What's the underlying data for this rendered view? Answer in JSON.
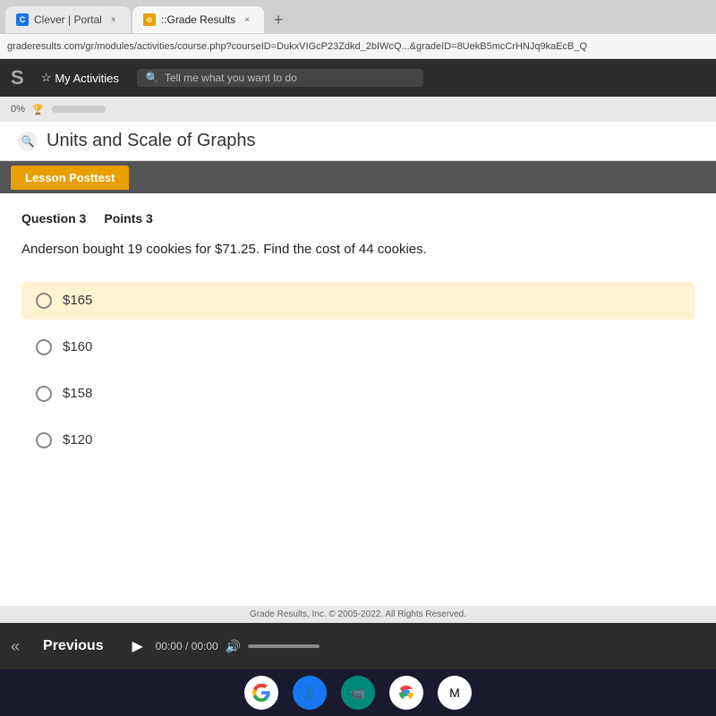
{
  "browser": {
    "tab1_label": "Clever | Portal",
    "tab2_label": "::Grade Results",
    "tab_close": "×",
    "tab_new": "+",
    "address_bar": "graderesults.com/gr/modules/activities/course.php?courseID=DukxVIGcP23Zdkd_2bIWcQ...&gradeID=8UekB5mcCrHNJq9kaEcB_Q"
  },
  "header": {
    "logo": "S",
    "nav_activities": "My Activities",
    "search_placeholder": "Tell me what you want to do",
    "progress_label": "0%"
  },
  "page": {
    "title": "Units and Scale of Graphs",
    "lesson_tab": "Lesson Posttest"
  },
  "question": {
    "number": "Question 3",
    "points": "Points 3",
    "text": "Anderson bought 19 cookies for $71.25. Find the cost of 44 cookies.",
    "options": [
      {
        "id": "a",
        "label": "$165",
        "selected": true
      },
      {
        "id": "b",
        "label": "$160",
        "selected": false
      },
      {
        "id": "c",
        "label": "$158",
        "selected": false
      },
      {
        "id": "d",
        "label": "$120",
        "selected": false
      }
    ]
  },
  "footer": {
    "prev_icon": "«",
    "prev_label": "Previous",
    "play_icon": "▶",
    "time_current": "00:00",
    "time_total": "00:00",
    "volume_icon": "🔊"
  },
  "copyright": "Grade Results, Inc. © 2005-2022. All Rights Reserved.",
  "taskbar": {
    "icons": [
      "G",
      "f",
      "M",
      "C",
      "M"
    ]
  }
}
